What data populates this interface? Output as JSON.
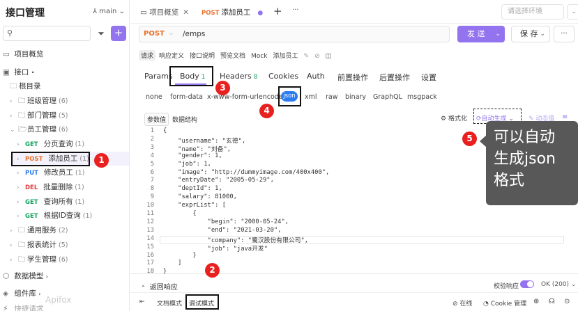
{
  "sidebar": {
    "title": "接口管理",
    "branch": "main",
    "add_label": "+",
    "overview": "项目概览",
    "interfaces": "接口",
    "root": "根目录",
    "items": [
      {
        "kind": "folder",
        "label": "班级管理",
        "count": "(6)"
      },
      {
        "kind": "folder",
        "label": "部门管理",
        "count": "(5)"
      },
      {
        "kind": "folder",
        "label": "员工管理",
        "count": "(6)"
      },
      {
        "kind": "api",
        "method": "GET",
        "label": "分页查询",
        "count": "(1)"
      },
      {
        "kind": "api",
        "method": "POST",
        "label": "添加员工",
        "count": "(1)"
      },
      {
        "kind": "api",
        "method": "PUT",
        "label": "修改员工",
        "count": "(1)"
      },
      {
        "kind": "api",
        "method": "DEL",
        "label": "批量删除",
        "count": "(1)"
      },
      {
        "kind": "api",
        "method": "GET",
        "label": "查询所有",
        "count": "(1)"
      },
      {
        "kind": "api",
        "method": "GET",
        "label": "根据ID查询",
        "count": "(1)"
      },
      {
        "kind": "folder",
        "label": "通用服务",
        "count": "(2)"
      },
      {
        "kind": "folder",
        "label": "报表统计",
        "count": "(5)"
      },
      {
        "kind": "folder",
        "label": "学生管理",
        "count": "(6)"
      }
    ],
    "data_model": "数据模型",
    "components": "组件库",
    "quick": "快捷请求",
    "watermark": "Apifox"
  },
  "tabs": {
    "tab1": "项目概览",
    "tab2_method": "POST",
    "tab2": "添加员工",
    "env_placeholder": "请选择环境"
  },
  "request": {
    "method": "POST",
    "path": "/emps",
    "send": "发 送",
    "save": "保 存"
  },
  "subtabs": [
    "请求",
    "响应定义",
    "接口说明",
    "预览文档",
    "Mock",
    "添加员工"
  ],
  "param_tabs": {
    "params": "Params",
    "body": "Body",
    "body_count": "1",
    "headers": "Headers",
    "headers_count": "8",
    "cookies": "Cookies",
    "auth": "Auth",
    "pre": "前置操作",
    "post": "后置操作",
    "settings": "设置"
  },
  "body_types": [
    "none",
    "form-data",
    "x-www-form-urlencoded",
    "json",
    "xml",
    "raw",
    "binary",
    "GraphQL",
    "msgpack"
  ],
  "editor": {
    "tab_param": "参数值",
    "tab_struct": "数据结构",
    "format": "格式化",
    "auto_gen": "自动生成",
    "dynamic": "动态值"
  },
  "code_lines": [
    "{",
    "    \"username\": \"玄德\",",
    "    \"name\": \"刘备\",",
    "    \"gender\": 1,",
    "    \"job\": 1,",
    "    \"image\": \"http://dummyimage.com/400x400\",",
    "    \"entryDate\": \"2005-05-29\",",
    "    \"deptId\": 1,",
    "    \"salary\": 81000,",
    "    \"exprList\": [",
    "        {",
    "            \"begin\": \"2000-05-24\",",
    "            \"end\": \"2021-03-20\",",
    "            \"company\": \"蜀汉股份有限公司\",",
    "            \"job\": \"java开发\"",
    "        }",
    "    ]",
    "}"
  ],
  "bottom": {
    "return": "返回响应",
    "verify": "校验响应",
    "ok": "OK (200)",
    "doc_mode": "文档模式",
    "debug_mode": "调试模式",
    "online": "在线",
    "cookie": "Cookie 管理"
  },
  "annotations": {
    "c1": "1",
    "c2": "2",
    "c3": "3",
    "c4": "4",
    "c5": "5",
    "callout": "可以自动生成json格式"
  }
}
